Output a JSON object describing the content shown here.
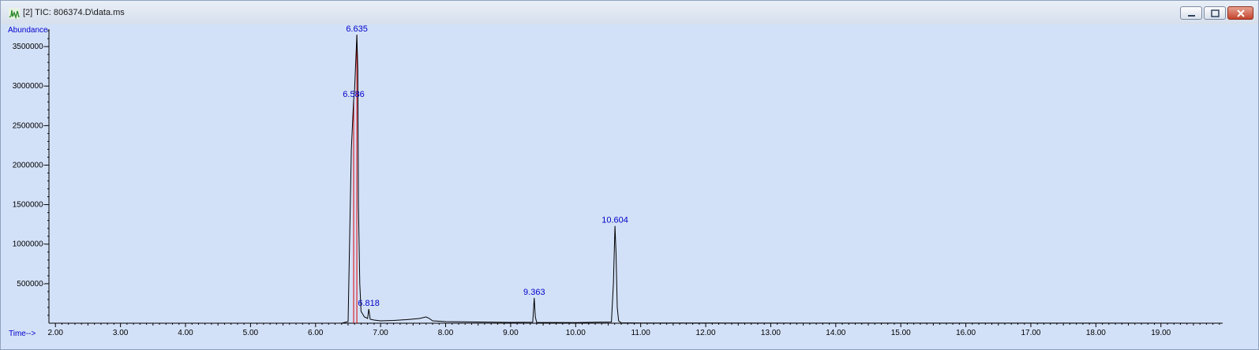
{
  "window": {
    "title": "[2] TIC: 806374.D\\data.ms",
    "icons": [
      "chromatogram-icon",
      "minimize-icon",
      "maximize-icon",
      "close-icon"
    ]
  },
  "colors": {
    "plot_background": "#d3e1f8",
    "trace": "#000000",
    "peak_label": "#0000cc",
    "baseline_marker": "#dd0000"
  },
  "chart_data": {
    "type": "line",
    "ylabel": "Abundance",
    "xlabel": "Time-->",
    "xlim": [
      1.9,
      19.95
    ],
    "ylim": [
      0,
      3720000
    ],
    "x_ticks": [
      2,
      3,
      4,
      5,
      6,
      7,
      8,
      9,
      10,
      11,
      12,
      13,
      14,
      15,
      16,
      17,
      18,
      19
    ],
    "x_tick_labels": [
      "2.00",
      "3.00",
      "4.00",
      "5.00",
      "6.00",
      "7.00",
      "8.00",
      "9.00",
      "10.00",
      "11.00",
      "12.00",
      "13.00",
      "14.00",
      "15.00",
      "16.00",
      "17.00",
      "18.00",
      "19.00"
    ],
    "y_ticks": [
      500000,
      1000000,
      1500000,
      2000000,
      2500000,
      3000000,
      3500000
    ],
    "y_tick_labels": [
      "500000",
      "1000000",
      "1500000",
      "2000000",
      "2500000",
      "3000000",
      "3500000"
    ],
    "grid": false,
    "series": [
      {
        "x": [
          2.0,
          6.4,
          6.5,
          6.55,
          6.586,
          6.6,
          6.635,
          6.65,
          6.66,
          6.68,
          6.7,
          6.75,
          6.8,
          6.818,
          6.84,
          6.9,
          7.0,
          7.2,
          7.4,
          7.6,
          7.7,
          7.75,
          7.8,
          8.0,
          8.5,
          9.0,
          9.34,
          9.363,
          9.38,
          9.4,
          10.0,
          10.55,
          10.58,
          10.604,
          10.62,
          10.64,
          10.66,
          10.7,
          11.0,
          12.0,
          14.0,
          16.0,
          18.0,
          19.95
        ],
        "y": [
          0,
          0,
          20000,
          2200000,
          2820000,
          2950000,
          3650000,
          3200000,
          1500000,
          500000,
          150000,
          80000,
          60000,
          180000,
          50000,
          40000,
          30000,
          35000,
          45000,
          60000,
          80000,
          60000,
          30000,
          20000,
          15000,
          10000,
          12000,
          320000,
          80000,
          10000,
          8000,
          15000,
          500000,
          1230000,
          900000,
          200000,
          30000,
          5000,
          3000,
          2000,
          1000,
          1000,
          1000,
          0
        ]
      }
    ],
    "peak_labels": [
      {
        "x": 6.635,
        "y": 3650000,
        "text": "6.635"
      },
      {
        "x": 6.586,
        "y": 2820000,
        "text": "6.586"
      },
      {
        "x": 6.818,
        "y": 180000,
        "text": "6.818"
      },
      {
        "x": 9.363,
        "y": 320000,
        "text": "9.363"
      },
      {
        "x": 10.604,
        "y": 1230000,
        "text": "10.604"
      }
    ],
    "integration_marks": [
      {
        "x": 6.586,
        "y": 2820000
      },
      {
        "x": 6.635,
        "y": 3650000
      }
    ]
  }
}
